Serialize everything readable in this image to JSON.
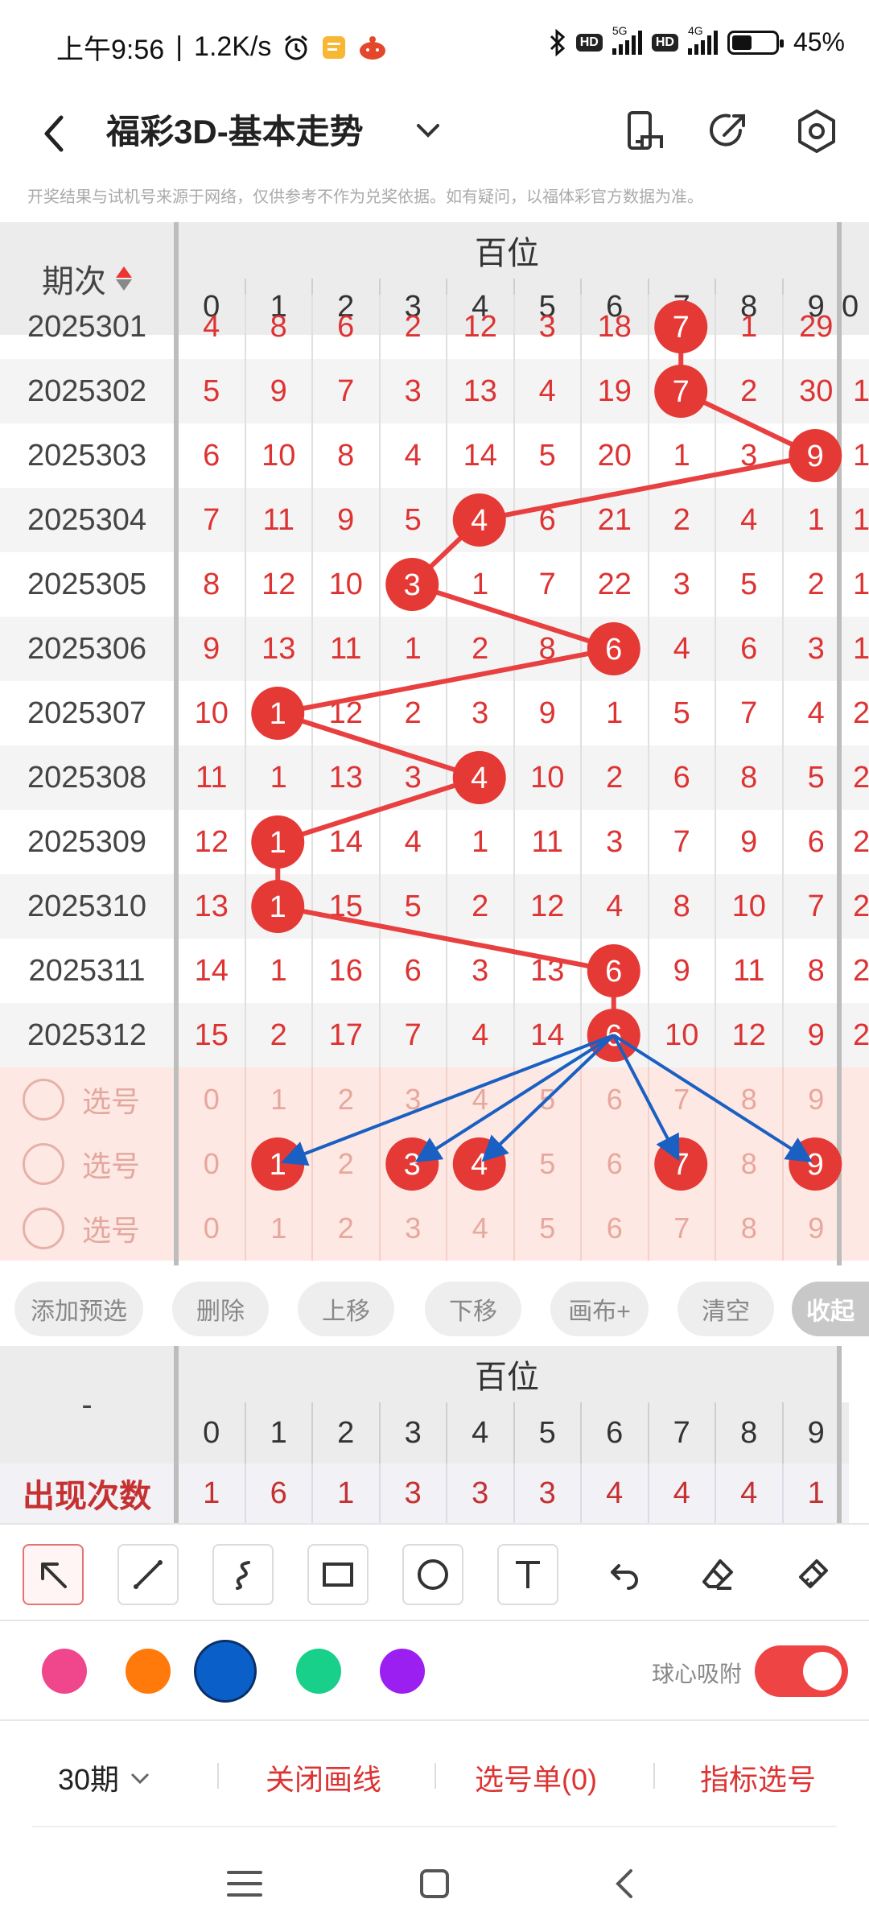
{
  "status_bar": {
    "time": "上午9:56",
    "net_speed": "1.2K/s",
    "battery_pct": "45%",
    "hd1": "HD",
    "hd2": "HD",
    "net1": "5G",
    "net2": "4G"
  },
  "header": {
    "title": "福彩3D-基本走势"
  },
  "disclaimer": "开奖结果与试机号来源于网络，仅供参考不作为兑奖依据。如有疑问，以福体彩官方数据为准。",
  "chart": {
    "period_header": "期次",
    "group_label": "百位",
    "digits": [
      "0",
      "1",
      "2",
      "3",
      "4",
      "5",
      "6",
      "7",
      "8",
      "9"
    ],
    "partial_row": {
      "period": "2025301",
      "values": [
        "4",
        "8",
        "6",
        "2",
        "12",
        "3",
        "18",
        "7",
        "1",
        "29"
      ]
    },
    "rows": [
      {
        "period": "2025302",
        "values": [
          "5",
          "9",
          "7",
          "3",
          "13",
          "4",
          "19",
          "7",
          "2",
          "30"
        ],
        "hit": 7,
        "edge": "1"
      },
      {
        "period": "2025303",
        "values": [
          "6",
          "10",
          "8",
          "4",
          "14",
          "5",
          "20",
          "1",
          "3",
          "9"
        ],
        "hit": 9,
        "edge": "1"
      },
      {
        "period": "2025304",
        "values": [
          "7",
          "11",
          "9",
          "5",
          "4",
          "6",
          "21",
          "2",
          "4",
          "1"
        ],
        "hit": 4,
        "edge": "1"
      },
      {
        "period": "2025305",
        "values": [
          "8",
          "12",
          "10",
          "3",
          "1",
          "7",
          "22",
          "3",
          "5",
          "2"
        ],
        "hit": 3,
        "edge": "1"
      },
      {
        "period": "2025306",
        "values": [
          "9",
          "13",
          "11",
          "1",
          "2",
          "8",
          "6",
          "4",
          "6",
          "3"
        ],
        "hit": 6,
        "edge": "1"
      },
      {
        "period": "2025307",
        "values": [
          "10",
          "1",
          "12",
          "2",
          "3",
          "9",
          "1",
          "5",
          "7",
          "4"
        ],
        "hit": 1,
        "edge": "2"
      },
      {
        "period": "2025308",
        "values": [
          "11",
          "1",
          "13",
          "3",
          "4",
          "10",
          "2",
          "6",
          "8",
          "5"
        ],
        "hit": 4,
        "edge": "2"
      },
      {
        "period": "2025309",
        "values": [
          "12",
          "1",
          "14",
          "4",
          "1",
          "11",
          "3",
          "7",
          "9",
          "6"
        ],
        "hit": 1,
        "edge": "2"
      },
      {
        "period": "2025310",
        "values": [
          "13",
          "1",
          "15",
          "5",
          "2",
          "12",
          "4",
          "8",
          "10",
          "7"
        ],
        "hit": 1,
        "edge": "2"
      },
      {
        "period": "2025311",
        "values": [
          "14",
          "1",
          "16",
          "6",
          "3",
          "13",
          "6",
          "9",
          "11",
          "8"
        ],
        "hit": 6,
        "edge": "2"
      },
      {
        "period": "2025312",
        "values": [
          "15",
          "2",
          "17",
          "7",
          "4",
          "14",
          "6",
          "10",
          "12",
          "9"
        ],
        "hit": 6,
        "edge": "2"
      }
    ],
    "pick_rows": [
      {
        "label": "选号",
        "values": [
          "0",
          "1",
          "2",
          "3",
          "4",
          "5",
          "6",
          "7",
          "8",
          "9"
        ],
        "selected": []
      },
      {
        "label": "选号",
        "values": [
          "0",
          "1",
          "2",
          "3",
          "4",
          "5",
          "6",
          "7",
          "8",
          "9"
        ],
        "selected": [
          1,
          3,
          4,
          7,
          9
        ]
      },
      {
        "label": "选号",
        "values": [
          "0",
          "1",
          "2",
          "3",
          "4",
          "5",
          "6",
          "7",
          "8",
          "9"
        ],
        "selected": []
      }
    ]
  },
  "actions": {
    "add_preselect": "添加预选",
    "delete": "删除",
    "move_up": "上移",
    "move_down": "下移",
    "canvas_plus": "画布+",
    "clear": "清空",
    "collapse": "收起"
  },
  "stats": {
    "corner": "-",
    "group_label": "百位",
    "digits": [
      "0",
      "1",
      "2",
      "3",
      "4",
      "5",
      "6",
      "7",
      "8",
      "9"
    ],
    "occurrence_label": "出现次数",
    "occurrences": [
      "1",
      "6",
      "1",
      "3",
      "3",
      "3",
      "4",
      "4",
      "4",
      "1"
    ]
  },
  "tools": [
    "pointer-icon",
    "line-icon",
    "curve-icon",
    "rectangle-icon",
    "circle-icon",
    "text-icon",
    "undo-icon",
    "eraser-icon",
    "clear-brush-icon"
  ],
  "colors": {
    "palette": [
      "#f0468c",
      "#ff7a0a",
      "#0a5fc8",
      "#19d08a",
      "#9b1ff0"
    ],
    "selected_index": 2,
    "accent": "#e53935",
    "line_red": "#e84040",
    "arrow_blue": "#1a5fc2"
  },
  "snap": {
    "label": "球心吸附",
    "enabled": true
  },
  "bottom_bar": {
    "period_count": "30期",
    "close_drawing": "关闭画线",
    "pick_list": "选号单(0)",
    "indicator_pick": "指标选号"
  }
}
